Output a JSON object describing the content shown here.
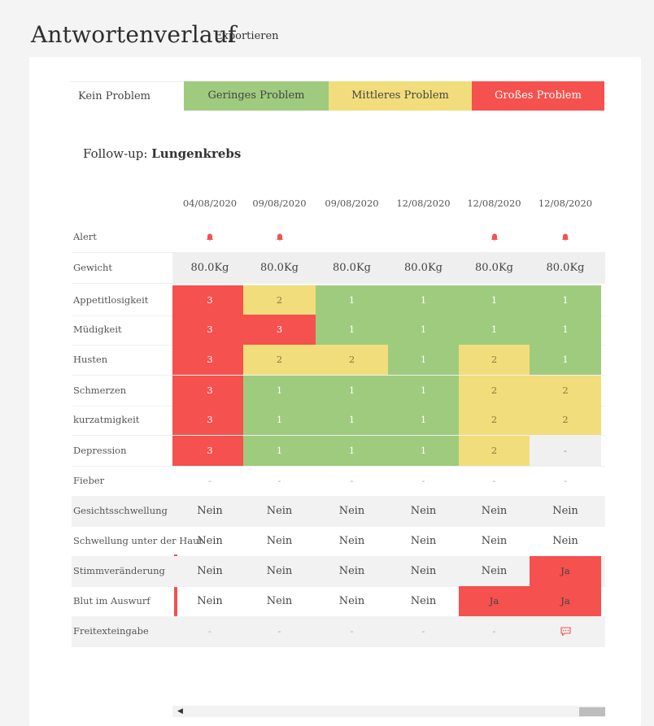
{
  "header": {
    "title": "Antwortenverlauf",
    "export_label": "Exportieren"
  },
  "legend": [
    "Kein Problem",
    "Geringes Problem",
    "Mittleres Problem",
    "Großes Problem"
  ],
  "colors": {
    "green": "#9fcb7e",
    "yellow": "#f1dd7b",
    "red": "#f4514f",
    "grey": "#f0f0f0"
  },
  "followup": {
    "prefix": "Follow-up:",
    "name": "Lungenkrebs"
  },
  "dates": [
    "04/08/2020",
    "09/08/2020",
    "09/08/2020",
    "12/08/2020",
    "12/08/2020",
    "12/08/2020"
  ],
  "rows": [
    {
      "label": "Alert",
      "type": "alert",
      "values": [
        true,
        true,
        false,
        false,
        true,
        true
      ]
    },
    {
      "label": "Gewicht",
      "type": "weight",
      "values": [
        "80.0Kg",
        "80.0Kg",
        "80.0Kg",
        "80.0Kg",
        "80.0Kg",
        "80.0Kg"
      ]
    },
    {
      "label": "Appetitlosigkeit",
      "type": "score",
      "values": [
        "3",
        "2",
        "1",
        "1",
        "1",
        "1"
      ]
    },
    {
      "label": "Müdigkeit",
      "type": "score",
      "values": [
        "3",
        "3",
        "1",
        "1",
        "1",
        "1"
      ]
    },
    {
      "label": "Husten",
      "type": "score",
      "values": [
        "3",
        "2",
        "2",
        "1",
        "2",
        "1"
      ]
    },
    {
      "label": "Schmerzen",
      "type": "score",
      "values": [
        "3",
        "1",
        "1",
        "1",
        "2",
        "2"
      ]
    },
    {
      "label": "kurzatmigkeit",
      "type": "score",
      "values": [
        "3",
        "1",
        "1",
        "1",
        "2",
        "2"
      ]
    },
    {
      "label": "Depression",
      "type": "score",
      "values": [
        "3",
        "1",
        "1",
        "1",
        "2",
        "-"
      ]
    },
    {
      "label": "Fieber",
      "type": "dash",
      "values": [
        "-",
        "-",
        "-",
        "-",
        "-",
        "-"
      ]
    },
    {
      "label": "Gesichtsschwellung",
      "type": "yesno",
      "values": [
        "Nein",
        "Nein",
        "Nein",
        "Nein",
        "Nein",
        "Nein"
      ]
    },
    {
      "label": "Schwellung unter der Haut",
      "type": "yesno",
      "values": [
        "Nein",
        "Nein",
        "Nein",
        "Nein",
        "Nein",
        "Nein"
      ]
    },
    {
      "label": "Stimmveränderung",
      "type": "yesno",
      "values": [
        "Nein",
        "Nein",
        "Nein",
        "Nein",
        "Nein",
        "Ja"
      ]
    },
    {
      "label": "Blut im Auswurf",
      "type": "yesno",
      "values": [
        "Nein",
        "Nein",
        "Nein",
        "Nein",
        "Ja",
        "Ja"
      ]
    },
    {
      "label": "Freitexteingabe",
      "type": "freetext",
      "values": [
        "-",
        "-",
        "-",
        "-",
        "-",
        "chat"
      ]
    }
  ],
  "icons": {
    "alert": "bell-icon",
    "freetext": "chat-bubble-icon",
    "scroll_left": "chevron-left-icon"
  }
}
